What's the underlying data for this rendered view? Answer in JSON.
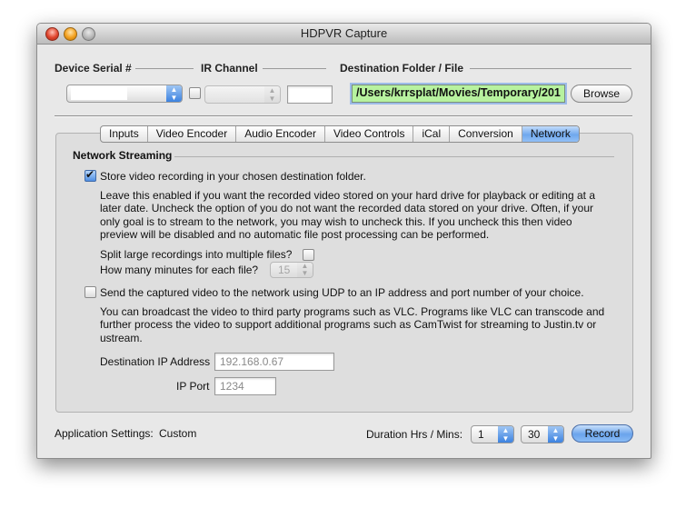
{
  "window": {
    "title": "HDPVR Capture"
  },
  "top": {
    "device_serial_label": "Device Serial #",
    "ir_channel_label": "IR Channel",
    "destination_label": "Destination Folder / File",
    "device_serial_value": "",
    "ir_channel_value": "",
    "ir_channel_text": "",
    "destination_path": "/Users/krrsplat/Movies/Temporary/201",
    "browse_label": "Browse"
  },
  "tabs": [
    "Inputs",
    "Video Encoder",
    "Audio Encoder",
    "Video Controls",
    "iCal",
    "Conversion",
    "Network"
  ],
  "active_tab": "Network",
  "network": {
    "section_title": "Network Streaming",
    "store_label": "Store video recording in your chosen destination folder.",
    "store_checked": true,
    "store_desc": "Leave this enabled if you want the recorded video stored on your hard drive for playback or editing at a later date. Uncheck the option of you do not want the recorded data stored on your drive. Often, if your only goal is to stream to the network, you may wish to uncheck this. If you uncheck this then video preview will be disabled and no automatic file post processing can be performed.",
    "split_label": "Split large recordings into multiple files?",
    "split_checked": false,
    "minutes_label": "How many minutes for each file?",
    "minutes_value": "15",
    "udp_label": "Send the captured video to the network using UDP to an IP address and port number of your choice.",
    "udp_checked": false,
    "udp_desc": "You can broadcast the video to third party programs such as VLC. Programs like VLC can transcode and further process the video to support additional programs such as CamTwist for streaming to Justin.tv or ustream.",
    "ip_label": "Destination IP Address",
    "ip_placeholder": "192.168.0.67",
    "port_label": "IP Port",
    "port_placeholder": "1234"
  },
  "bottom": {
    "app_settings_label": "Application Settings:",
    "app_settings_value": "Custom",
    "duration_label": "Duration Hrs / Mins:",
    "hours_value": "1",
    "minutes_value": "30",
    "record_label": "Record"
  }
}
